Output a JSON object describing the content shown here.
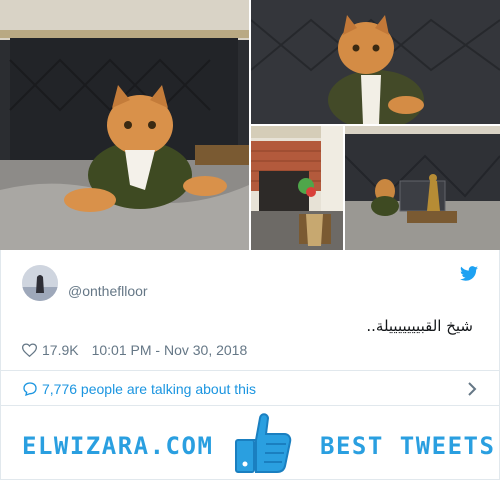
{
  "tweet": {
    "handle": "@ontheflloor",
    "text": "شيخ القبيييييييلة..",
    "likes": "17.9K",
    "timestamp": "10:01 PM - Nov 30, 2018"
  },
  "conversation": {
    "label": "7,776 people are talking about this"
  },
  "banner": {
    "site": "ELWIZARA.COM",
    "tagline": "BEST TWEETS"
  },
  "colors": {
    "twitter_blue": "#1da1f2",
    "link_blue": "#1b95e0",
    "muted": "#657786",
    "banner_blue": "#2a9fe0"
  },
  "icons": {
    "info": "info-icon",
    "twitter": "twitter-bird-icon",
    "like": "heart-icon",
    "reply": "speech-bubble-icon",
    "chevron": "chevron-right-icon",
    "thumbs": "thumbs-up-icon"
  }
}
